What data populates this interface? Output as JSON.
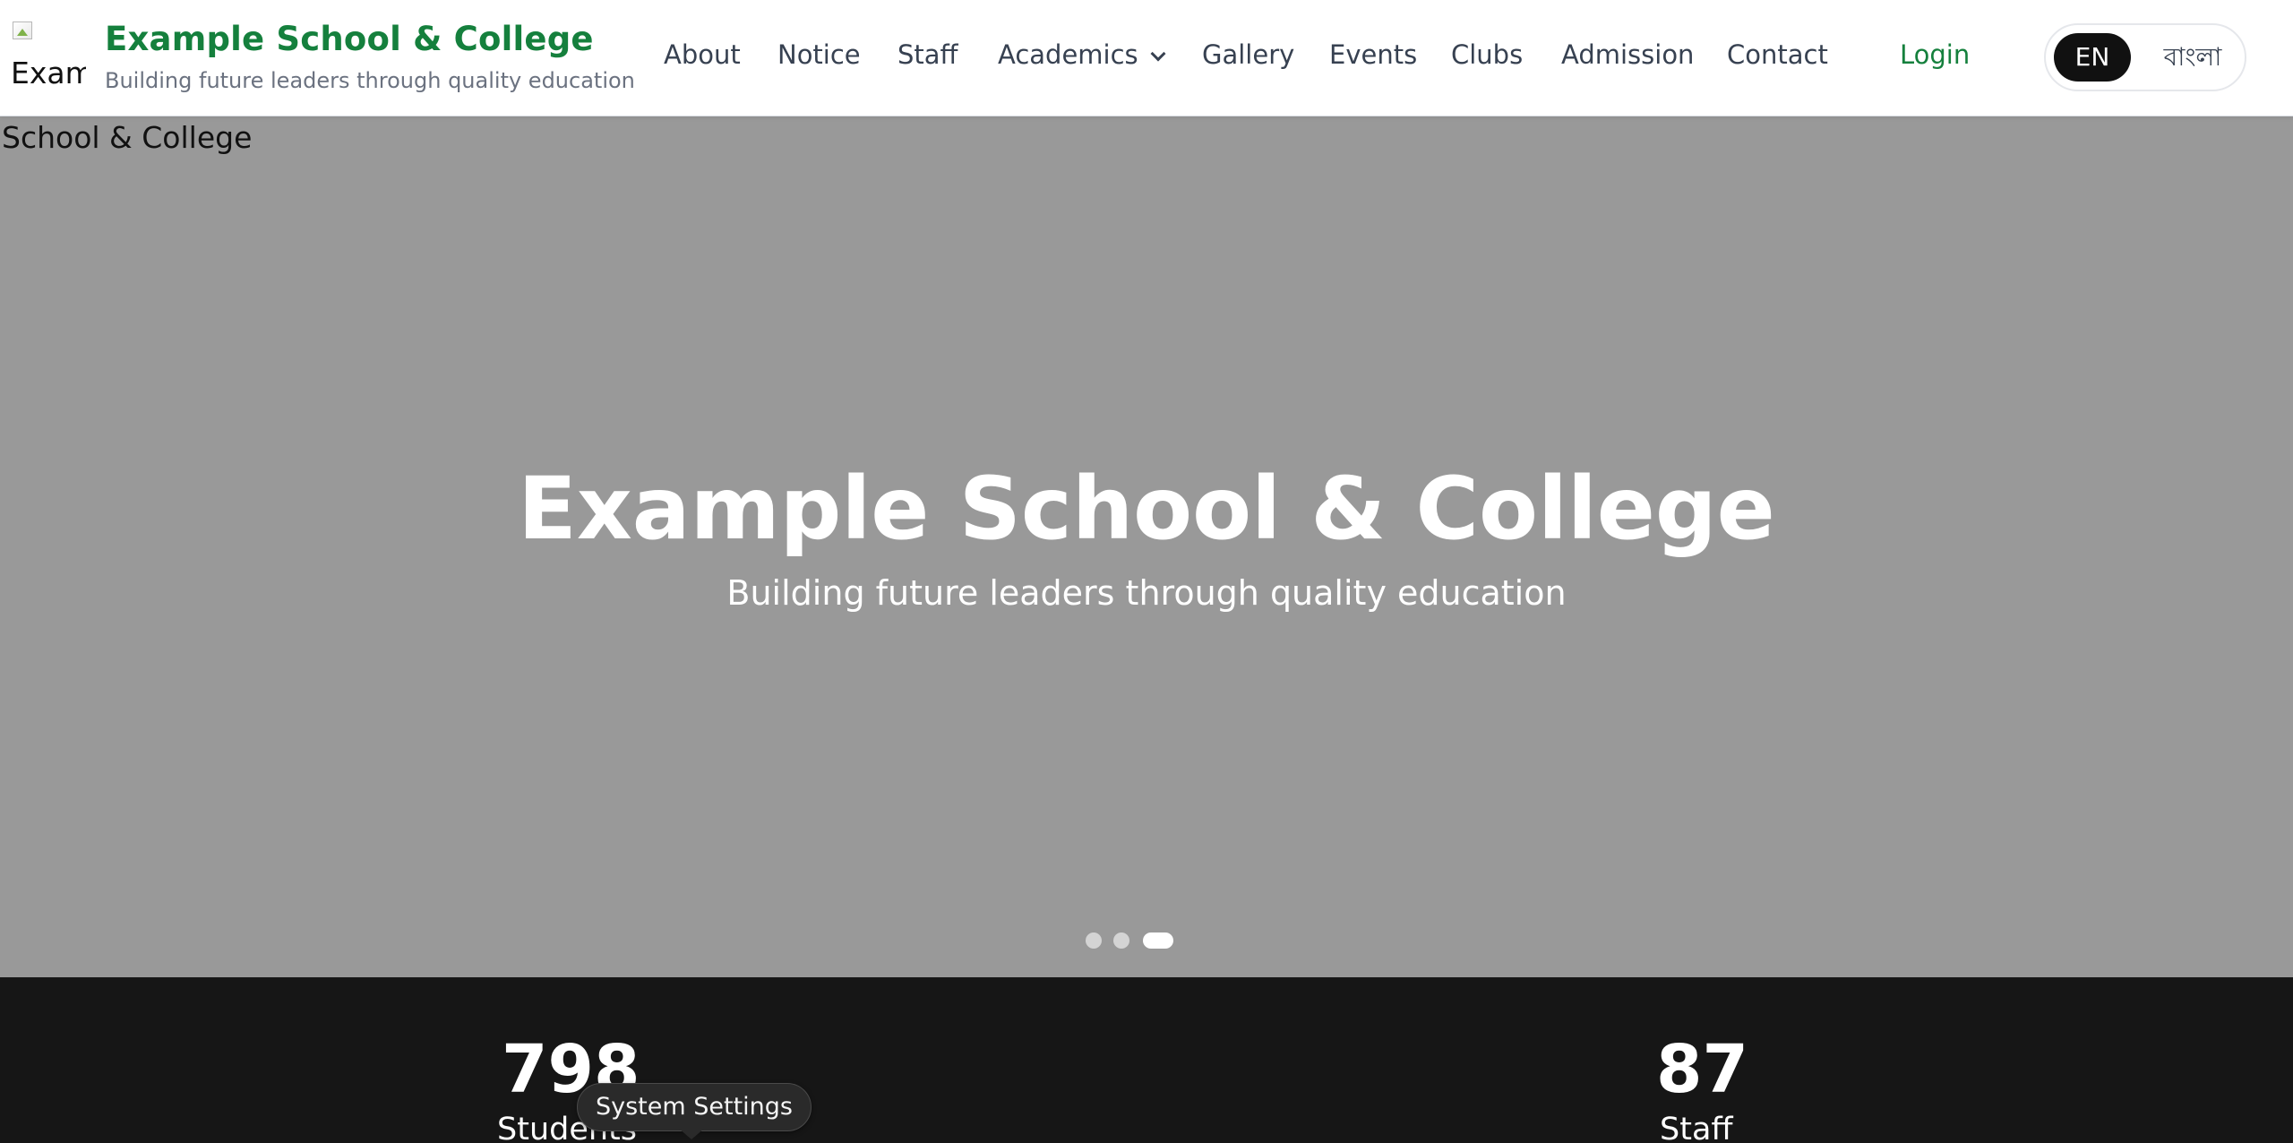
{
  "header": {
    "logo_alt": "Exam",
    "brand_title": "Example School & College",
    "brand_subtitle": "Building future leaders through quality education",
    "nav": [
      "About",
      "Notice",
      "Staff",
      "Academics",
      "Gallery",
      "Events",
      "Clubs",
      "Admission",
      "Contact"
    ],
    "login_label": "Login",
    "lang_en": "EN",
    "lang_bn": "বাংলা"
  },
  "hero": {
    "image_alt": "School & College",
    "title": "Example School & College",
    "subtitle": "Building future leaders through quality education",
    "slide_count": 3,
    "active_slide": 3
  },
  "stats": [
    {
      "value": "798",
      "label": "Students"
    },
    {
      "value": "87",
      "label": "Staff"
    }
  ],
  "tooltip": {
    "text": "System Settings"
  },
  "colors": {
    "brand_green": "#15803d",
    "hero_bg": "#999999",
    "stats_bg": "#161616"
  }
}
